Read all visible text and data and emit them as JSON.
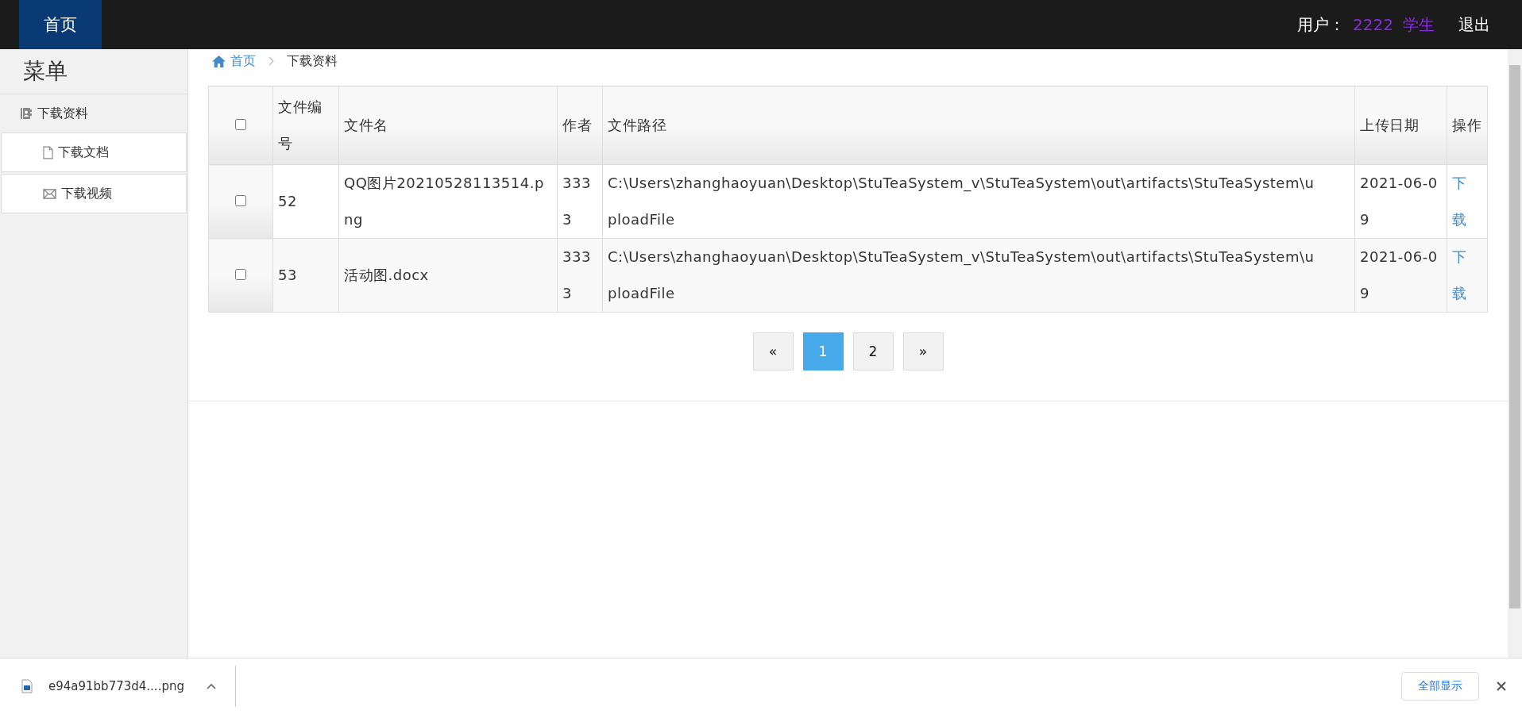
{
  "top_nav": [
    {
      "label": "首页",
      "selected": true
    }
  ],
  "user": {
    "label": "用户：",
    "id": "2222",
    "role": "学生",
    "logout": "退出"
  },
  "sidebar": {
    "title": "菜单",
    "group": {
      "label": "下载资料",
      "expanded": true,
      "children": [
        {
          "label": "下载文档",
          "kind": "document"
        },
        {
          "label": "下载视频",
          "kind": "video"
        }
      ]
    }
  },
  "breadcrumb": [
    {
      "label": "首页",
      "kind": "home"
    },
    {
      "label": "下载资料",
      "kind": "current"
    }
  ],
  "table": {
    "select_all": {
      "checked": false
    },
    "columns": [
      "文件编号",
      "文件名",
      "作者",
      "文件路径",
      "上传日期",
      "操作"
    ],
    "rows": [
      {
        "checked": false,
        "id": "52",
        "name": "QQ图片20210528113514.png",
        "author": "3333",
        "path": "C:\\Users\\zhanghaoyuan\\Desktop\\StuTeaSystem_v\\StuTeaSystem\\out\\artifacts\\StuTeaSystem\\uploadFile",
        "date": "2021-06-09",
        "action": "下载"
      },
      {
        "checked": false,
        "id": "53",
        "name": "活动图.docx",
        "author": "3333",
        "path": "C:\\Users\\zhanghaoyuan\\Desktop\\StuTeaSystem_v\\StuTeaSystem\\out\\artifacts\\StuTeaSystem\\uploadFile",
        "date": "2021-06-09",
        "action": "下载"
      }
    ]
  },
  "pagination": {
    "prev": "«",
    "pages": [
      {
        "label": "1",
        "selected": true
      },
      {
        "label": "2",
        "selected": false
      }
    ],
    "next": "»"
  },
  "download_bar": {
    "file": "e94a91bb773d4....png",
    "show_all": "全部显示"
  }
}
